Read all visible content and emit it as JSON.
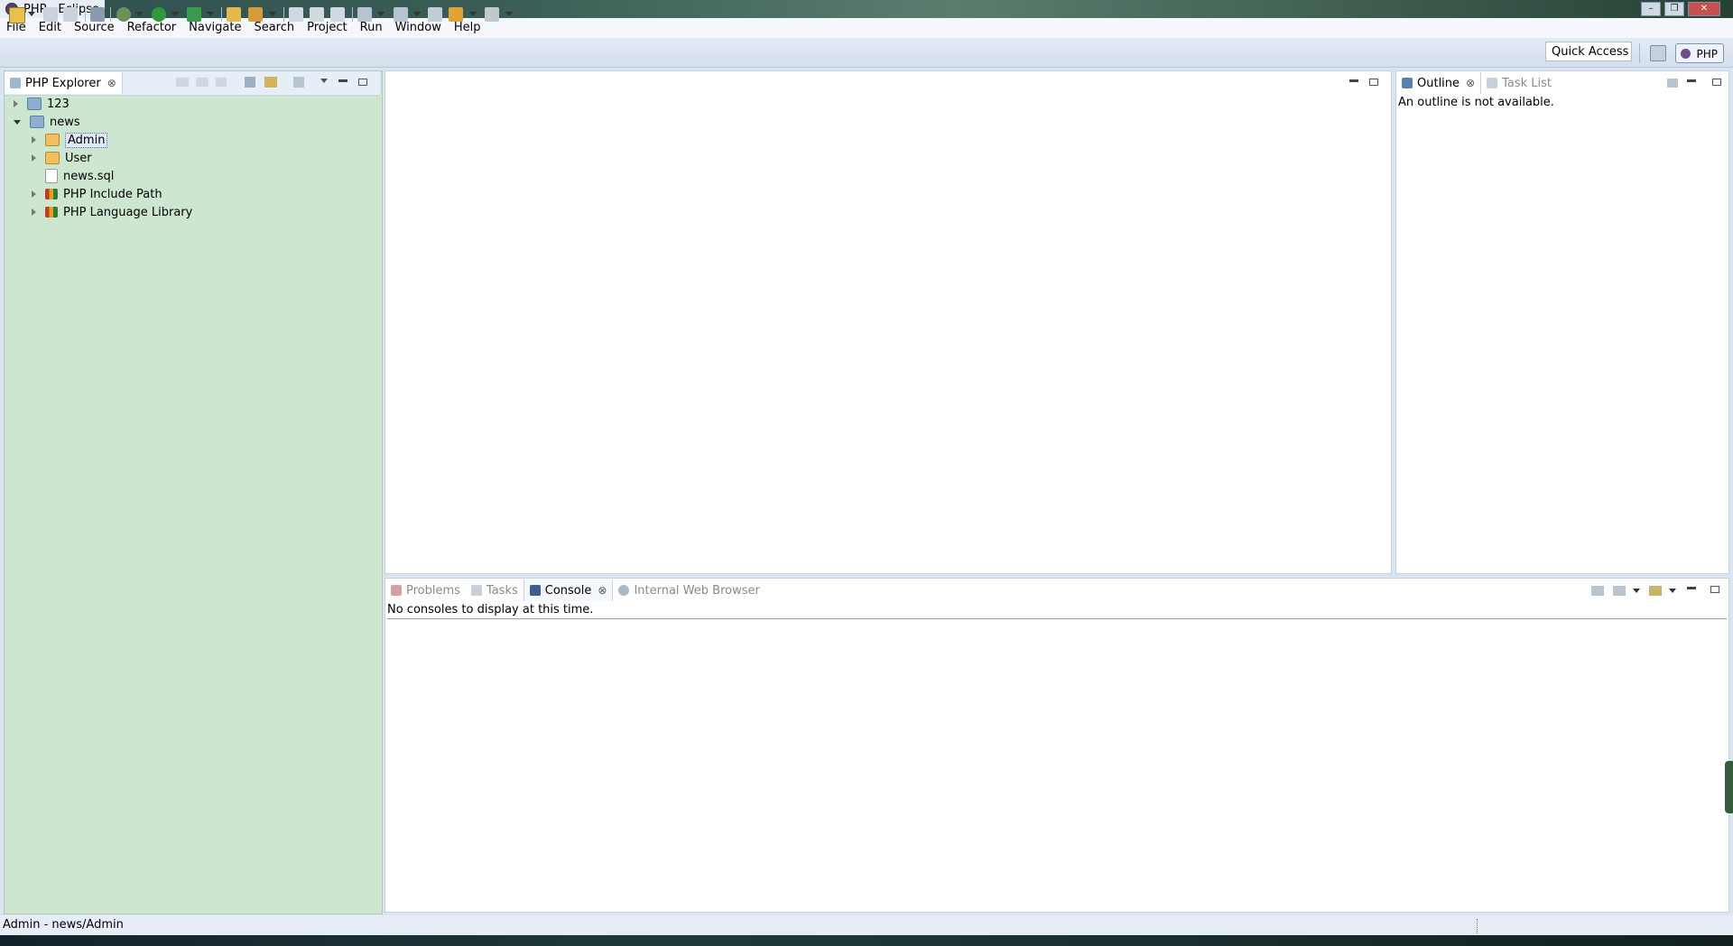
{
  "window": {
    "title": "PHP - Eclipse",
    "controls": [
      "minimize-icon",
      "restore-icon",
      "close-icon"
    ]
  },
  "menu": [
    "File",
    "Edit",
    "Source",
    "Refactor",
    "Navigate",
    "Search",
    "Project",
    "Run",
    "Window",
    "Help"
  ],
  "toolbar": {
    "quick_access": "Quick Access",
    "perspective": "PHP"
  },
  "explorer": {
    "tab_label": "PHP Explorer",
    "tree": [
      {
        "label": "123",
        "icon": "project-folder-icon",
        "expandable": true,
        "expanded": false
      },
      {
        "label": "news",
        "icon": "project-folder-icon",
        "expandable": true,
        "expanded": true
      },
      {
        "label": "Admin",
        "icon": "package-folder-icon",
        "expandable": true,
        "expanded": false,
        "selected": true
      },
      {
        "label": "User",
        "icon": "package-folder-icon",
        "expandable": true,
        "expanded": false
      },
      {
        "label": "news.sql",
        "icon": "file-icon",
        "expandable": false
      },
      {
        "label": "PHP Include Path",
        "icon": "library-icon",
        "expandable": true,
        "expanded": false
      },
      {
        "label": "PHP Language Library",
        "icon": "library-icon",
        "expandable": true,
        "expanded": false
      }
    ]
  },
  "outline": {
    "tabs": [
      "Outline",
      "Task List"
    ],
    "message": "An outline is not available."
  },
  "console": {
    "tabs": [
      "Problems",
      "Tasks",
      "Console",
      "Internal Web Browser"
    ],
    "message": "No consoles to display at this time."
  },
  "status": {
    "text": "Admin - news/Admin"
  },
  "colors": {
    "explorer_bg": "#cde6d0",
    "chrome_bg": "#dbe5f1"
  }
}
